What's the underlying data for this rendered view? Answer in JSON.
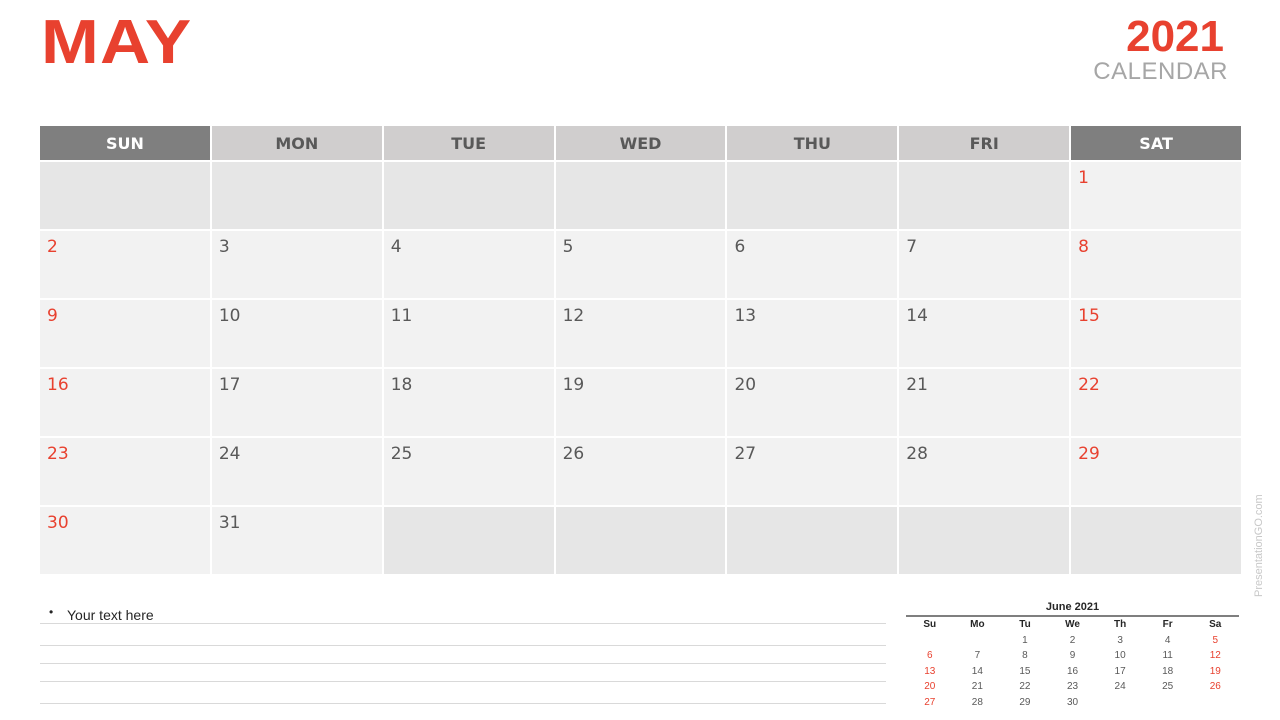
{
  "header": {
    "month": "MAY",
    "year": "2021",
    "subtitle": "CALENDAR"
  },
  "colors": {
    "accent": "#e8412f",
    "weekend_header": "#7f7f7f",
    "weekday_header": "#d0cece",
    "cell": "#f2f2f2",
    "empty_cell": "#e6e6e6",
    "text": "#595959"
  },
  "calendar": {
    "weekdays": [
      "SUN",
      "MON",
      "TUE",
      "WED",
      "THU",
      "FRI",
      "SAT"
    ],
    "weeks": [
      [
        "",
        "",
        "",
        "",
        "",
        "",
        "1"
      ],
      [
        "2",
        "3",
        "4",
        "5",
        "6",
        "7",
        "8"
      ],
      [
        "9",
        "10",
        "11",
        "12",
        "13",
        "14",
        "15"
      ],
      [
        "16",
        "17",
        "18",
        "19",
        "20",
        "21",
        "22"
      ],
      [
        "23",
        "24",
        "25",
        "26",
        "27",
        "28",
        "29"
      ],
      [
        "30",
        "31",
        "",
        "",
        "",
        "",
        ""
      ]
    ]
  },
  "notes": {
    "bullet_text": "Your text here"
  },
  "mini_calendar": {
    "title": "June 2021",
    "weekdays": [
      "Su",
      "Mo",
      "Tu",
      "We",
      "Th",
      "Fr",
      "Sa"
    ],
    "weeks": [
      [
        "",
        "",
        "1",
        "2",
        "3",
        "4",
        "5"
      ],
      [
        "6",
        "7",
        "8",
        "9",
        "10",
        "11",
        "12"
      ],
      [
        "13",
        "14",
        "15",
        "16",
        "17",
        "18",
        "19"
      ],
      [
        "20",
        "21",
        "22",
        "23",
        "24",
        "25",
        "26"
      ],
      [
        "27",
        "28",
        "29",
        "30",
        "",
        "",
        ""
      ]
    ]
  },
  "watermark": "PresentationGO.com"
}
